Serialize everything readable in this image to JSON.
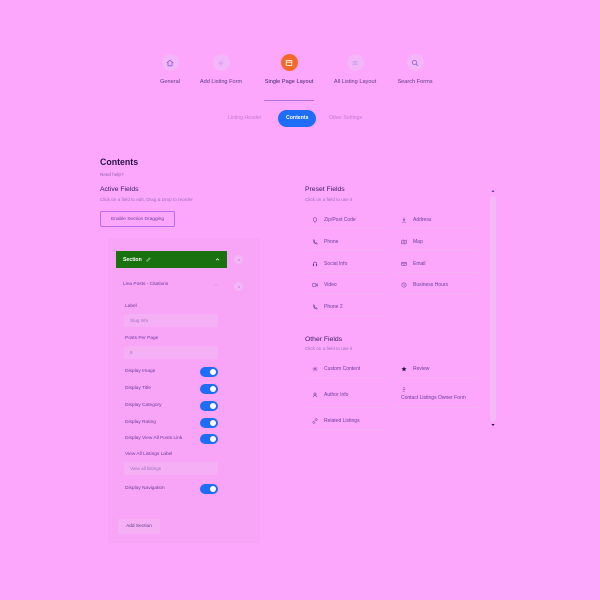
{
  "steps": [
    {
      "label": "General",
      "icon": "home-icon"
    },
    {
      "label": "Add Listing Form",
      "icon": "plus-icon"
    },
    {
      "label": "Single Page Layout",
      "icon": "layout-icon"
    },
    {
      "label": "All Listing Layout",
      "icon": "list-icon"
    },
    {
      "label": "Search Forms",
      "icon": "search-icon"
    }
  ],
  "subtabs": [
    "Listing Header",
    "Contents",
    "Other Settings"
  ],
  "page": {
    "title": "Contents",
    "need_help": "Need help?"
  },
  "active_fields": {
    "title": "Active Fields",
    "subtitle": "Click on a field to edit, Drag & Drop to reorder",
    "enable_button": "Enable Section Dragging",
    "section_label": "Section",
    "widget_title": "Lina Posts - Citations",
    "inputs": [
      {
        "label": "Label",
        "value": "Slug Info"
      },
      {
        "label": "Posts Per Page",
        "value": "5"
      }
    ],
    "toggles": [
      {
        "label": "Display Image",
        "on": true
      },
      {
        "label": "Display Title",
        "on": true
      },
      {
        "label": "Display Category",
        "on": true
      },
      {
        "label": "Display Rating",
        "on": true
      },
      {
        "label": "Display View All Posts Link",
        "on": true
      }
    ],
    "view_all_label": "View All Listings Label",
    "view_all_value": "View all listings",
    "nav_toggle": {
      "label": "Display Navigation",
      "on": true
    },
    "add_section": "Add Section"
  },
  "preset_fields": {
    "title": "Preset Fields",
    "subtitle": "Click on a field to use it",
    "items": [
      {
        "label": "Zip/Post Code",
        "icon": "pin-icon"
      },
      {
        "label": "Address",
        "icon": "map-pin-icon"
      },
      {
        "label": "Phone",
        "icon": "phone-icon"
      },
      {
        "label": "Map",
        "icon": "map-icon"
      },
      {
        "label": "Social Info",
        "icon": "headset-icon"
      },
      {
        "label": "Email",
        "icon": "email-icon"
      },
      {
        "label": "Video",
        "icon": "video-icon"
      },
      {
        "label": "Business Hours",
        "icon": "clock-icon"
      },
      {
        "label": "Phone 2",
        "icon": "phone-icon"
      }
    ]
  },
  "other_fields": {
    "title": "Other Fields",
    "subtitle": "Click on a field to use it",
    "items": [
      {
        "label": "Custom Content",
        "icon": "gear-icon"
      },
      {
        "label": "Review",
        "icon": "star-icon"
      },
      {
        "label": "Author Info",
        "icon": "user-icon"
      },
      {
        "label": "Contact Listings Owner Form",
        "icon": "form-icon"
      },
      {
        "label": "Related Listings",
        "icon": "link-icon"
      }
    ]
  },
  "colors": {
    "background": "#fca6fc",
    "accent": "#1f6df7",
    "active_step": "#f36a28",
    "section_bar": "#1a7110"
  }
}
